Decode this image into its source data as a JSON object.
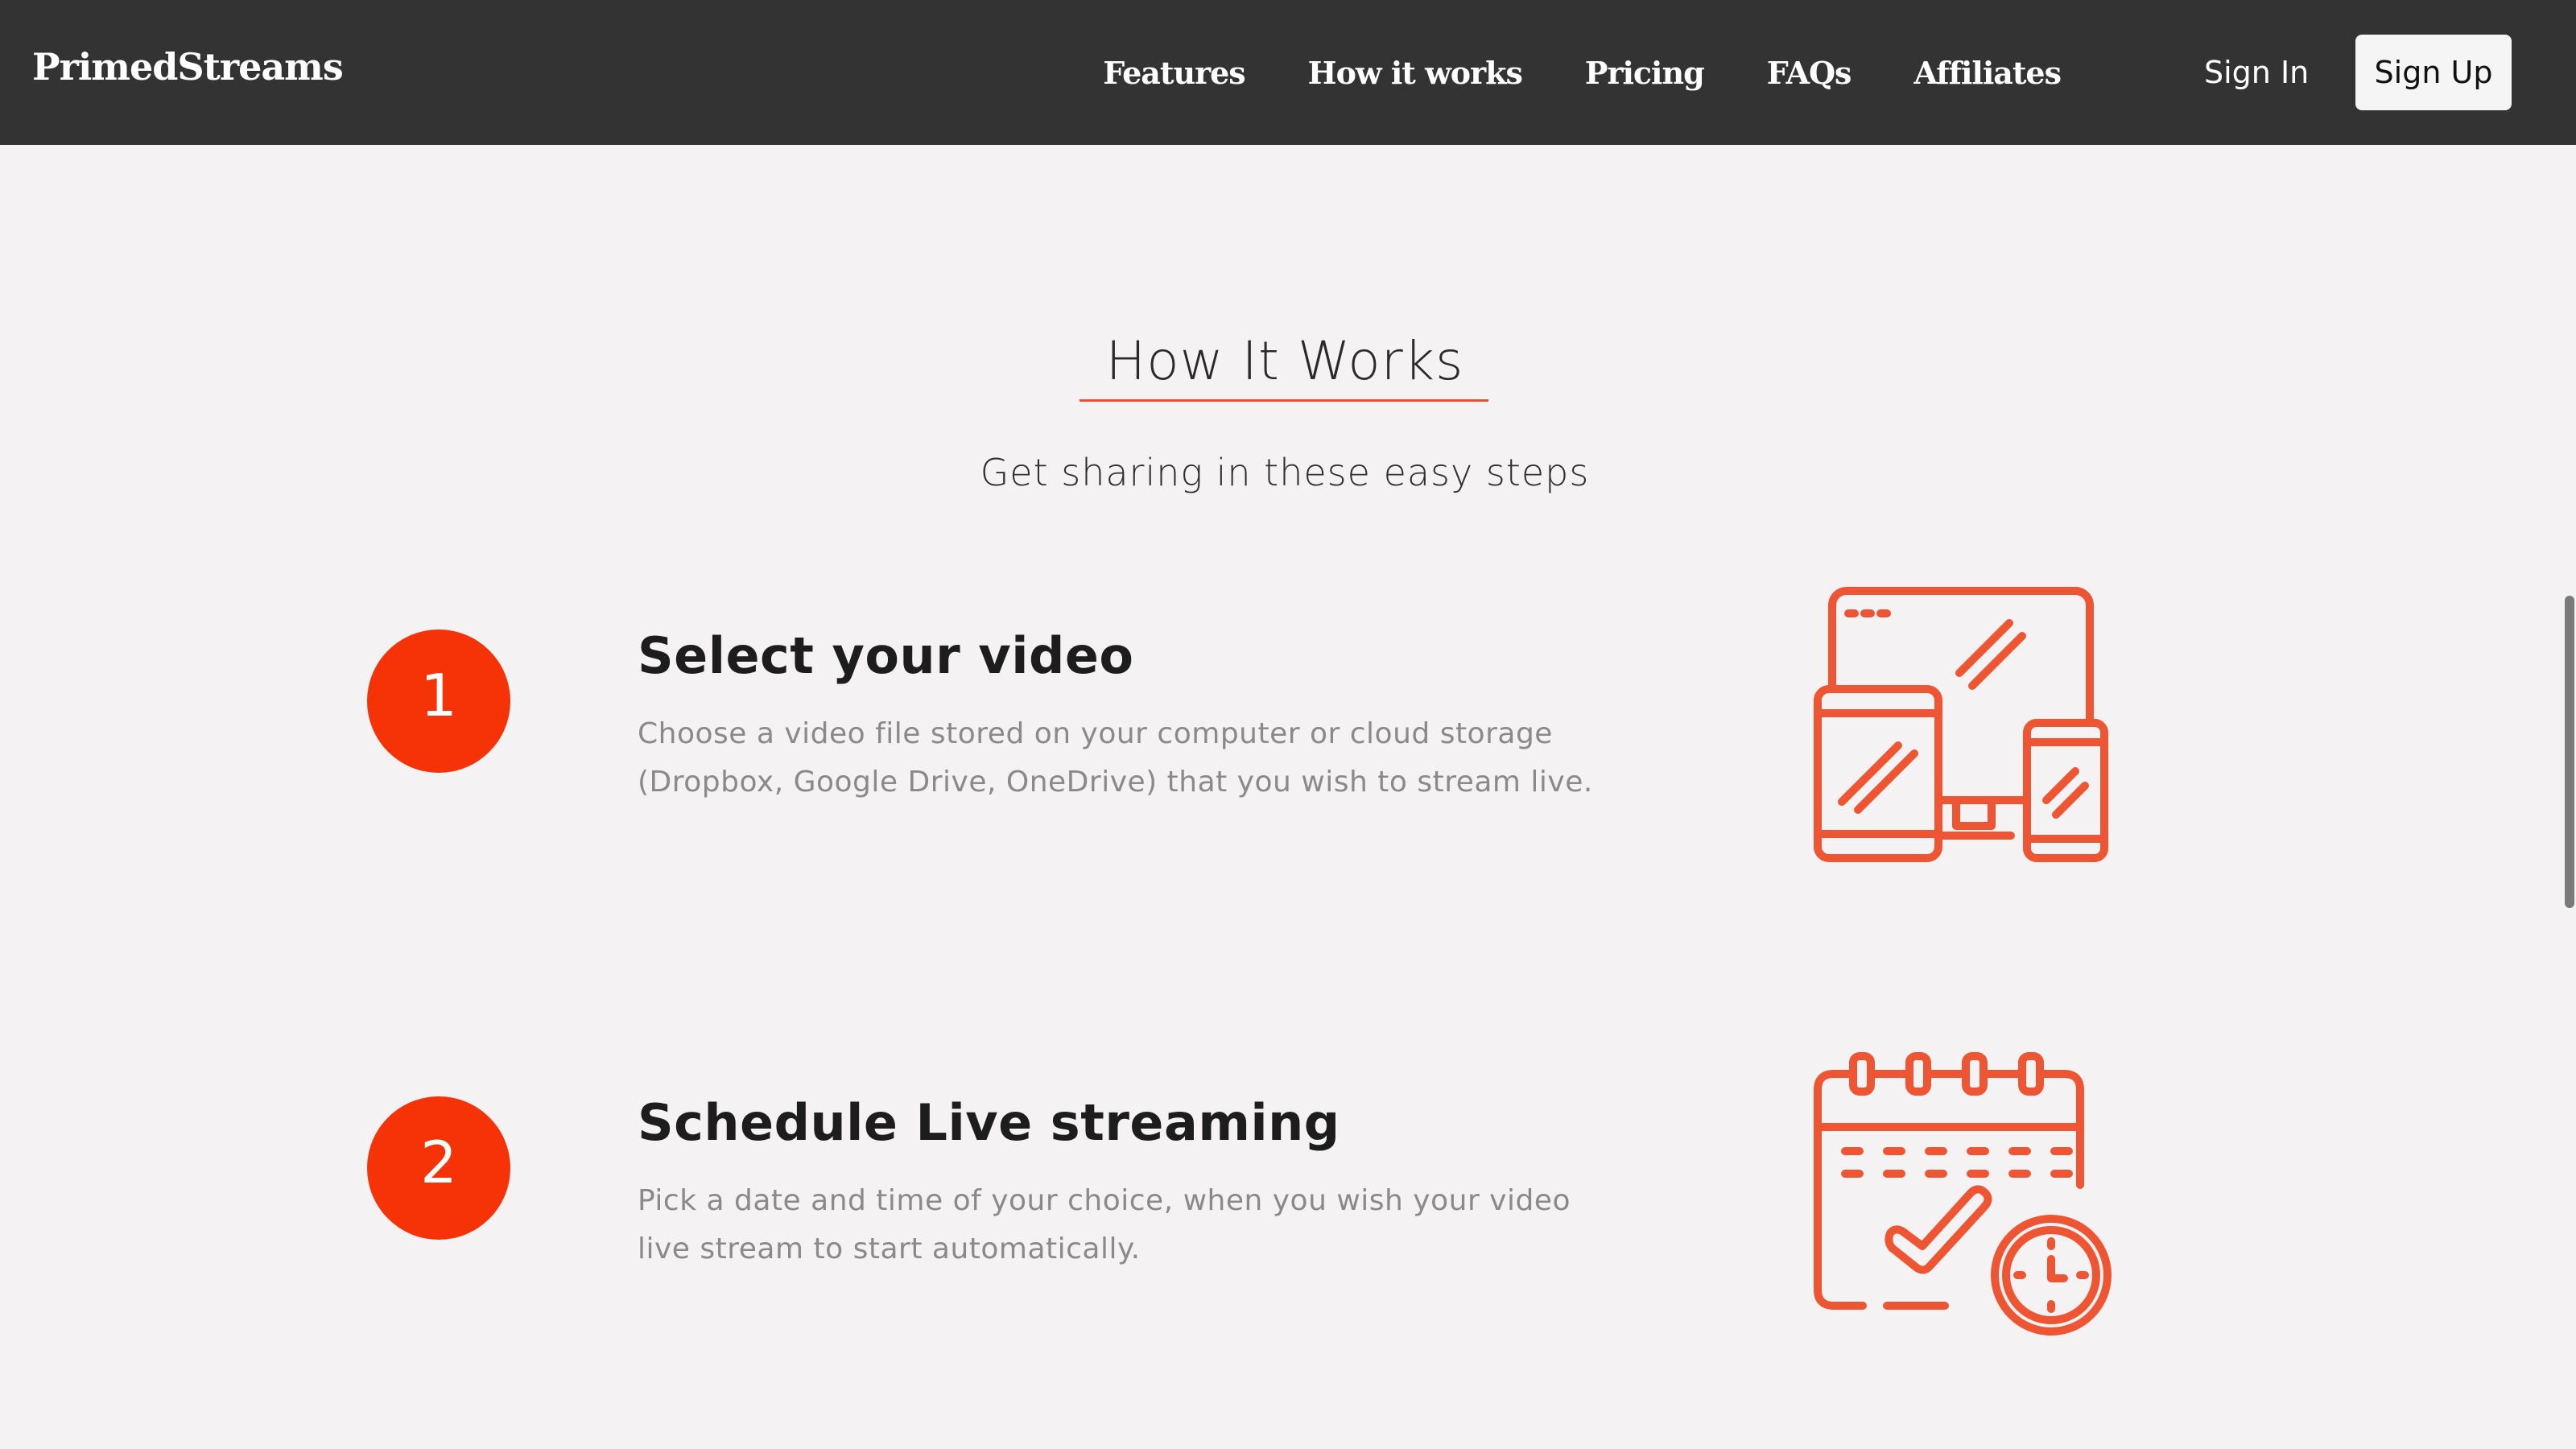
{
  "nav": {
    "brand": "PrimedStreams",
    "links": [
      {
        "label": "Features"
      },
      {
        "label": "How it works"
      },
      {
        "label": "Pricing"
      },
      {
        "label": "FAQs"
      },
      {
        "label": "Affiliates"
      }
    ],
    "sign_in": "Sign In",
    "sign_up": "Sign Up"
  },
  "section": {
    "title": "How It Works",
    "subtitle": "Get sharing in these easy steps"
  },
  "steps": [
    {
      "number": "1",
      "title": "Select your video",
      "description": "Choose a video file stored on your computer or cloud storage (Dropbox, Google Drive, OneDrive) that you wish to stream live.",
      "icon": "devices-icon"
    },
    {
      "number": "2",
      "title": "Schedule Live streaming",
      "description": "Pick a date and time of your choice, when you wish your video live stream to start automatically.",
      "icon": "calendar-clock-icon"
    }
  ],
  "colors": {
    "navbar_bg": "#333333",
    "page_bg": "#f4f2f3",
    "accent": "#f53307",
    "icon_stroke": "#ee5533",
    "description_text": "#8a8a8a"
  }
}
